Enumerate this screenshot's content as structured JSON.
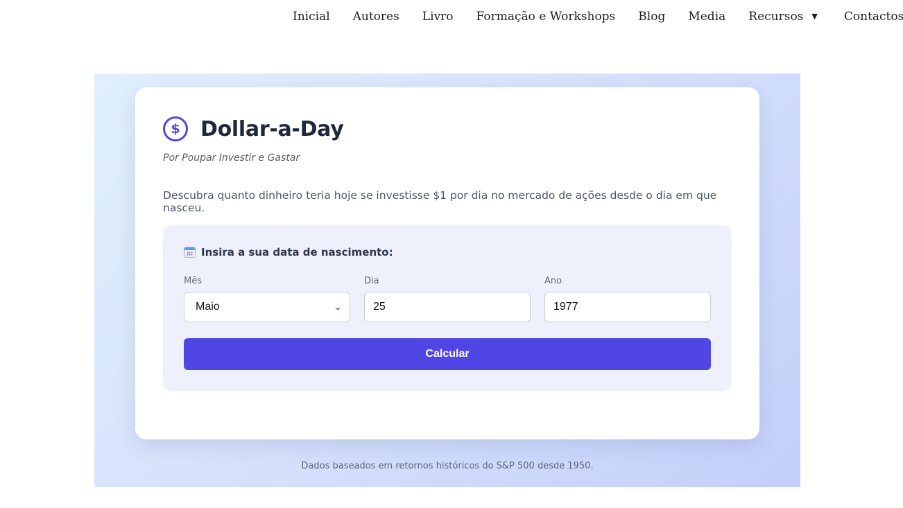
{
  "nav": {
    "items": [
      "Inicial",
      "Autores",
      "Livro",
      "Formação e Workshops",
      "Blog",
      "Media"
    ],
    "dropdown_label": "Recursos",
    "contact_label": "Contactos"
  },
  "calculator": {
    "icon": "dollar-circle-icon",
    "title": "Dollar-a-Day",
    "subtitle": "Por Poupar Investir e Gastar",
    "description": "Descubra quanto dinheiro teria hoje se investisse $1 por dia no mercado de ações desde o dia em que nasceu.",
    "form": {
      "icon": "calendar-icon",
      "label": "Insira a sua data de nascimento:",
      "month_label": "Mês",
      "month_value": "Maio",
      "day_label": "Dia",
      "day_value": "25",
      "year_label": "Ano",
      "year_value": "1977",
      "submit_label": "Calcular"
    },
    "footnote": "Dados baseados em retornos históricos do S&P 500 desde 1950."
  },
  "colors": {
    "accent": "#4f46e5",
    "form_background": "#eef1fc",
    "title_text": "#1e293b"
  }
}
